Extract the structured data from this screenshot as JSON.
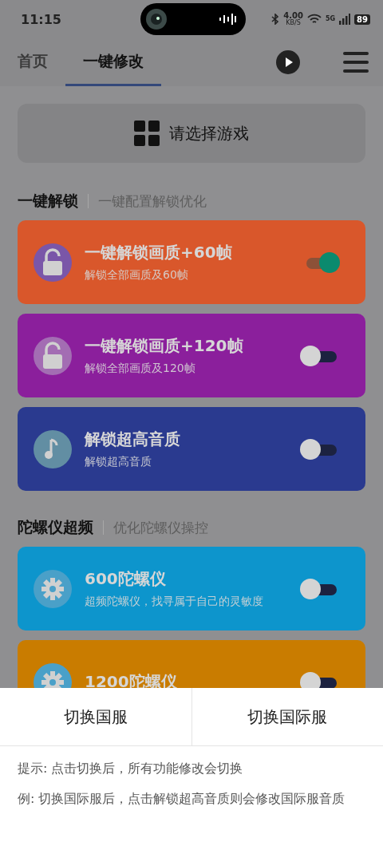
{
  "status_bar": {
    "time": "11:15",
    "net_speed": "4.00",
    "net_unit": "KB/S",
    "network": "5G",
    "battery": "89"
  },
  "nav": {
    "tabs": [
      {
        "label": "首页",
        "selected": false
      },
      {
        "label": "一键修改",
        "selected": true
      }
    ]
  },
  "game_picker": {
    "label": "请选择游戏"
  },
  "sections": [
    {
      "title": "一键解锁",
      "subtitle": "一键配置解锁优化",
      "items": [
        {
          "kind": "unlock",
          "title": "一键解锁画质+60帧",
          "description": "解锁全部画质及60帧",
          "color": "#d9572b",
          "on": true
        },
        {
          "kind": "unlock",
          "title": "一键解锁画质+120帧",
          "description": "解锁全部画质及120帧",
          "color": "#8b1f9c",
          "on": false
        },
        {
          "kind": "music",
          "title": "解锁超高音质",
          "description": "解锁超高音质",
          "color": "#2a3a8f",
          "on": false
        }
      ]
    },
    {
      "title": "陀螺仪超频",
      "subtitle": "优化陀螺仪操控",
      "items": [
        {
          "kind": "gear",
          "title": "600陀螺仪",
          "description": "超频陀螺仪，找寻属于自己的灵敏度",
          "color": "#0d95cc",
          "on": false
        },
        {
          "kind": "gear",
          "title": "1200陀螺仪",
          "color": "#c97c00",
          "on": false
        }
      ]
    }
  ],
  "sheet": {
    "buttons": [
      "切换国服",
      "切换国际服"
    ],
    "notes": [
      "提示: 点击切换后，所有功能修改会切换",
      "例: 切换国际服后，点击解锁超高音质则会修改国际服音质"
    ]
  }
}
